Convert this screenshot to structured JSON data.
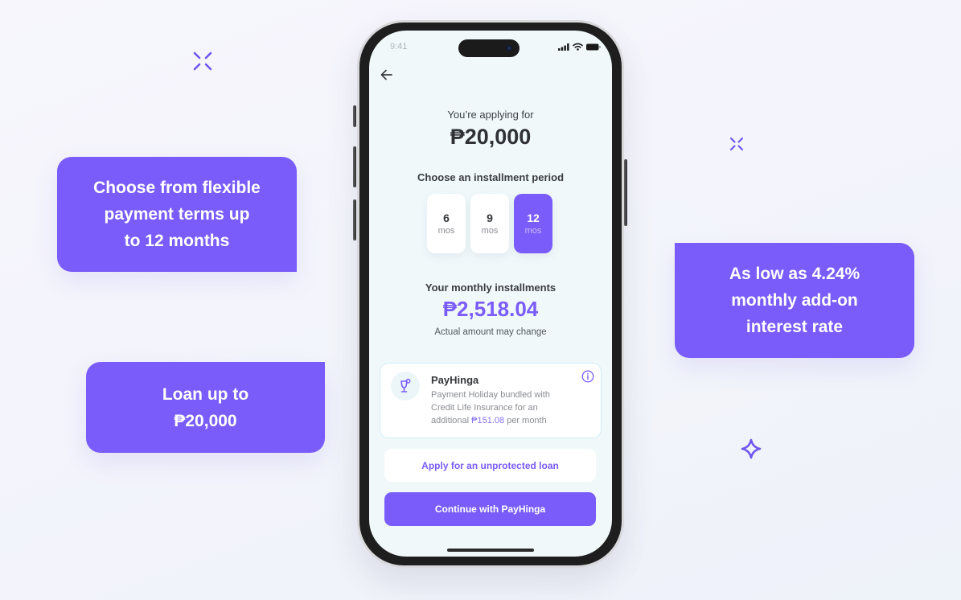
{
  "colors": {
    "accent": "#7a5cfa",
    "screen_bg": "#f0f8fa",
    "card_border": "#cfeef7"
  },
  "callouts": {
    "flexible_terms": "Choose from flexible\npayment terms up\nto 12 months",
    "loan_limit": "Loan up to\n₱20,000",
    "interest_rate": "As low as 4.24%\nmonthly add-on\ninterest rate"
  },
  "decorations": [
    "sparkle-x-icon",
    "sparkle-x-icon",
    "sparkle-diamond-icon"
  ],
  "phone": {
    "status_bar": {
      "time": "9:41",
      "icons": [
        "signal-icon",
        "wifi-icon",
        "battery-icon"
      ]
    },
    "back_icon": "arrow-left-icon",
    "applying_label": "You’re applying for",
    "applying_amount": "₱20,000",
    "period_label": "Choose an installment period",
    "periods": [
      {
        "value": "6",
        "unit": "mos",
        "selected": false
      },
      {
        "value": "9",
        "unit": "mos",
        "selected": false
      },
      {
        "value": "12",
        "unit": "mos",
        "selected": true
      }
    ],
    "monthly_label": "Your monthly installments",
    "monthly_amount": "₱2,518.04",
    "monthly_note": "Actual amount may change",
    "payhinga_card": {
      "icon": "glass-icon",
      "title": "PayHinga",
      "desc_prefix": "Payment Holiday bundled with Credit Life Insurance for an additional ",
      "desc_amount": "₱151.08",
      "desc_suffix": " per month",
      "info_icon": "info-icon"
    },
    "secondary_button": "Apply for an unprotected loan",
    "primary_button": "Continue with PayHinga"
  }
}
